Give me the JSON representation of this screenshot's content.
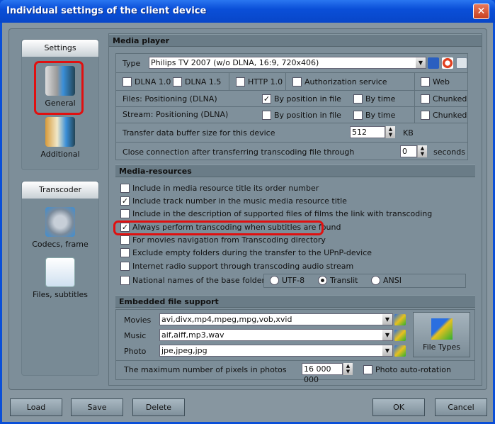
{
  "window": {
    "title": "Individual settings of the client device",
    "close": "✕"
  },
  "sidebar": {
    "settings_header": "Settings",
    "settings_items": [
      {
        "label": "General",
        "icon": "device-film-icon",
        "selected": true
      },
      {
        "label": "Additional",
        "icon": "clipboard-film-icon"
      }
    ],
    "transcoder_header": "Transcoder",
    "transcoder_items": [
      {
        "label": "Codecs, frame",
        "icon": "gears-film-icon"
      },
      {
        "label": "Files, subtitles",
        "icon": "file-gear-icon"
      }
    ]
  },
  "media_player": {
    "header": "Media player",
    "type_label": "Type",
    "type_value": "Philips TV 2007 (w/o DLNA, 16:9, 720x406)",
    "dlna10": {
      "label": "DLNA 1.0",
      "checked": false
    },
    "dlna15": {
      "label": "DLNA 1.5",
      "checked": false
    },
    "http10": {
      "label": "HTTP 1.0",
      "checked": false
    },
    "auth": {
      "label": "Authorization service",
      "checked": false
    },
    "web": {
      "label": "Web",
      "checked": false
    },
    "files_label": "Files: Positioning (DLNA)",
    "files_bypos": {
      "label": "By position in file",
      "checked": true
    },
    "files_bytime": {
      "label": "By time",
      "checked": false
    },
    "files_chunked": {
      "label": "Chunked",
      "checked": false
    },
    "stream_label": "Stream: Positioning (DLNA)",
    "stream_bypos": {
      "label": "By position in file",
      "checked": false
    },
    "stream_bytime": {
      "label": "By time",
      "checked": false
    },
    "stream_chunked": {
      "label": "Chunked",
      "checked": false
    },
    "buffer_label": "Transfer data buffer size for this device",
    "buffer_value": "512",
    "buffer_unit": "KB",
    "close_label": "Close connection after transferring transcoding file through",
    "close_value": "0",
    "close_unit": "seconds"
  },
  "media_resources": {
    "header": "Media-resources",
    "items": [
      {
        "label": "Include in media resource title its order number",
        "checked": false
      },
      {
        "label": "Include track number in the music media resource title",
        "checked": true
      },
      {
        "label": "Include in the description of supported files of films the link with transcoding",
        "checked": false
      },
      {
        "label": "Always perform transcoding when subtitles are found",
        "checked": true
      },
      {
        "label": "For movies navigation from Transcoding directory",
        "checked": false
      },
      {
        "label": "Exclude empty folders during the transfer to the UPnP-device",
        "checked": false
      },
      {
        "label": "Internet radio support through transcoding audio stream",
        "checked": false
      },
      {
        "label": "National names of the base folders",
        "checked": false
      }
    ],
    "encodings": [
      {
        "label": "UTF-8",
        "selected": false
      },
      {
        "label": "Translit",
        "selected": true
      },
      {
        "label": "ANSI",
        "selected": false
      }
    ]
  },
  "embedded": {
    "header": "Embedded file support",
    "movies_label": "Movies",
    "movies_value": "avi,divx,mp4,mpeg,mpg,vob,xvid",
    "music_label": "Music",
    "music_value": "aif,aiff,mp3,wav",
    "photo_label": "Photo",
    "photo_value": "jpe,jpeg,jpg",
    "file_types": "File Types",
    "max_pixels_label": "The maximum number of pixels in photos",
    "max_pixels_value": "16 000 000",
    "autorot": {
      "label": "Photo auto-rotation",
      "checked": false
    }
  },
  "buttons": {
    "load": "Load",
    "save": "Save",
    "delete": "Delete",
    "ok": "OK",
    "cancel": "Cancel"
  },
  "colors": {
    "highlight": "#e01010",
    "titlebar": "#0a4fd8",
    "panel": "#7d8e99"
  }
}
